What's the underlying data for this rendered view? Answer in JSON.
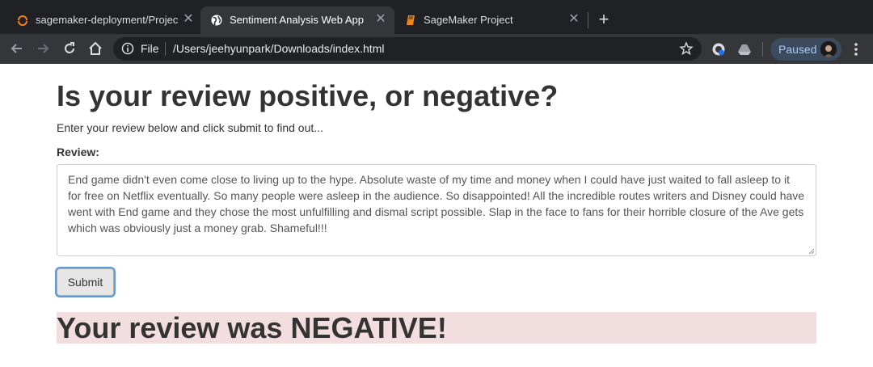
{
  "browser": {
    "tabs": [
      {
        "title": "sagemaker-deployment/Projec",
        "favicon": "sagemaker-orange-icon",
        "active": false
      },
      {
        "title": "Sentiment Analysis Web App",
        "favicon": "globe-icon",
        "active": true
      },
      {
        "title": "SageMaker Project",
        "favicon": "book-orange-icon",
        "active": false
      }
    ],
    "close_glyph": "✕",
    "new_tab_glyph": "+",
    "omnibox": {
      "scheme_label": "File",
      "url": "/Users/jeehyunpark/Downloads/index.html"
    },
    "profile": {
      "label": "Paused"
    },
    "colors": {
      "tabstrip": "#202124",
      "toolbar": "#35363a",
      "paused_bg": "#3c4a5e",
      "paused_text": "#a8c7fa"
    }
  },
  "page": {
    "heading": "Is your review positive, or negative?",
    "intro": "Enter your review below and click submit to find out...",
    "review_label": "Review:",
    "review_text": "End game didn't even come close to living up to the hype. Absolute waste of my time and money when I could have just waited to fall asleep to it for free on Netflix eventually. So many people were asleep in the audience. So disappointed! All the incredible routes writers and Disney could have went with End game and they chose the most unfulfilling and dismal script possible. Slap in the face to fans for their horrible closure of the Ave gets which was obviously just a money grab. Shameful!!!",
    "submit_label": "Submit",
    "result_text": "Your review was NEGATIVE!",
    "colors": {
      "result_bg": "#f2dede",
      "text": "#333333"
    }
  }
}
